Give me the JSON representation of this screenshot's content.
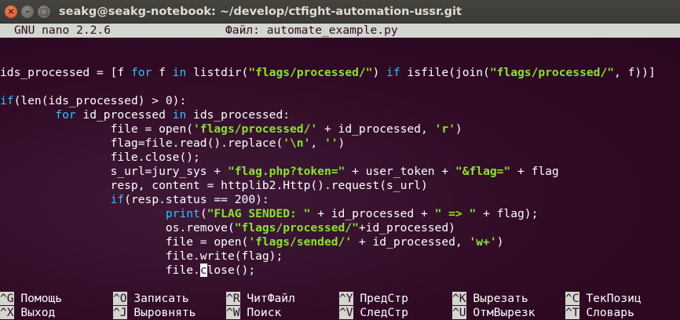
{
  "window": {
    "title": "seakg@seakg-notebook: ~/develop/ctfight-automation-ussr.git",
    "close_glyph": "×",
    "minimize_glyph": "–",
    "maximize_glyph": "□"
  },
  "nano": {
    "version": "GNU nano 2.2.6",
    "file_label": "Файл: automate_example.py"
  },
  "code_lines": [
    [],
    [
      {
        "t": "ids_processed = [f "
      },
      {
        "t": "for",
        "c": "kw"
      },
      {
        "t": " f "
      },
      {
        "t": "in",
        "c": "kw"
      },
      {
        "t": " listdir("
      },
      {
        "t": "\"flags/processed/\"",
        "c": "str"
      },
      {
        "t": ") "
      },
      {
        "t": "if",
        "c": "kw"
      },
      {
        "t": " isfile(join("
      },
      {
        "t": "\"flags/processed/\"",
        "c": "str"
      },
      {
        "t": ", f))]"
      }
    ],
    [],
    [
      {
        "t": "if",
        "c": "kw"
      },
      {
        "t": "(len(ids_processed) > 0):"
      }
    ],
    [
      {
        "t": "        "
      },
      {
        "t": "for",
        "c": "kw"
      },
      {
        "t": " id_processed "
      },
      {
        "t": "in",
        "c": "kw"
      },
      {
        "t": " ids_processed:"
      }
    ],
    [
      {
        "t": "                file = open("
      },
      {
        "t": "'flags/processed/'",
        "c": "str"
      },
      {
        "t": " + id_processed, "
      },
      {
        "t": "'r'",
        "c": "str"
      },
      {
        "t": ")"
      }
    ],
    [
      {
        "t": "                flag=file.read().replace("
      },
      {
        "t": "'\\n'",
        "c": "str"
      },
      {
        "t": ", "
      },
      {
        "t": "''",
        "c": "str"
      },
      {
        "t": ")"
      }
    ],
    [
      {
        "t": "                file.close();"
      }
    ],
    [
      {
        "t": "                s_url=jury_sys + "
      },
      {
        "t": "\"flag.php?token=\"",
        "c": "str"
      },
      {
        "t": " + user_token + "
      },
      {
        "t": "\"&flag=\"",
        "c": "str"
      },
      {
        "t": " + flag"
      }
    ],
    [
      {
        "t": "                resp, content = httplib2.Http().request(s_url)"
      }
    ],
    [
      {
        "t": "                "
      },
      {
        "t": "if",
        "c": "kw"
      },
      {
        "t": "(resp.status == 200):"
      }
    ],
    [
      {
        "t": "                        "
      },
      {
        "t": "print",
        "c": "kw"
      },
      {
        "t": "("
      },
      {
        "t": "\"FLAG SENDED: \"",
        "c": "str"
      },
      {
        "t": " + id_processed + "
      },
      {
        "t": "\" => \"",
        "c": "str"
      },
      {
        "t": " + flag);"
      }
    ],
    [
      {
        "t": "                        os.remove("
      },
      {
        "t": "\"flags/processed/\"",
        "c": "str"
      },
      {
        "t": "+id_processed)"
      }
    ],
    [
      {
        "t": "                        file = open("
      },
      {
        "t": "'flags/sended/'",
        "c": "str"
      },
      {
        "t": " + id_processed, "
      },
      {
        "t": "'w+'",
        "c": "str"
      },
      {
        "t": ")"
      }
    ],
    [
      {
        "t": "                        file.write(flag);"
      }
    ],
    [
      {
        "t": "                        file."
      },
      {
        "t": "c",
        "c": "cursor"
      },
      {
        "t": "lose();"
      }
    ]
  ],
  "shortcuts": [
    [
      {
        "key": "^G",
        "label": " Помощь"
      },
      {
        "key": "^O",
        "label": " Записать"
      },
      {
        "key": "^R",
        "label": " ЧитФайл"
      },
      {
        "key": "^Y",
        "label": " ПредСтр"
      },
      {
        "key": "^K",
        "label": " Вырезать"
      },
      {
        "key": "^C",
        "label": " ТекПозиц"
      }
    ],
    [
      {
        "key": "^X",
        "label": " Выход"
      },
      {
        "key": "^J",
        "label": " Выровнять"
      },
      {
        "key": "^W",
        "label": " Поиск"
      },
      {
        "key": "^V",
        "label": " СледСтр"
      },
      {
        "key": "^U",
        "label": " ОтмВырезк"
      },
      {
        "key": "^T",
        "label": " Словарь"
      }
    ]
  ]
}
